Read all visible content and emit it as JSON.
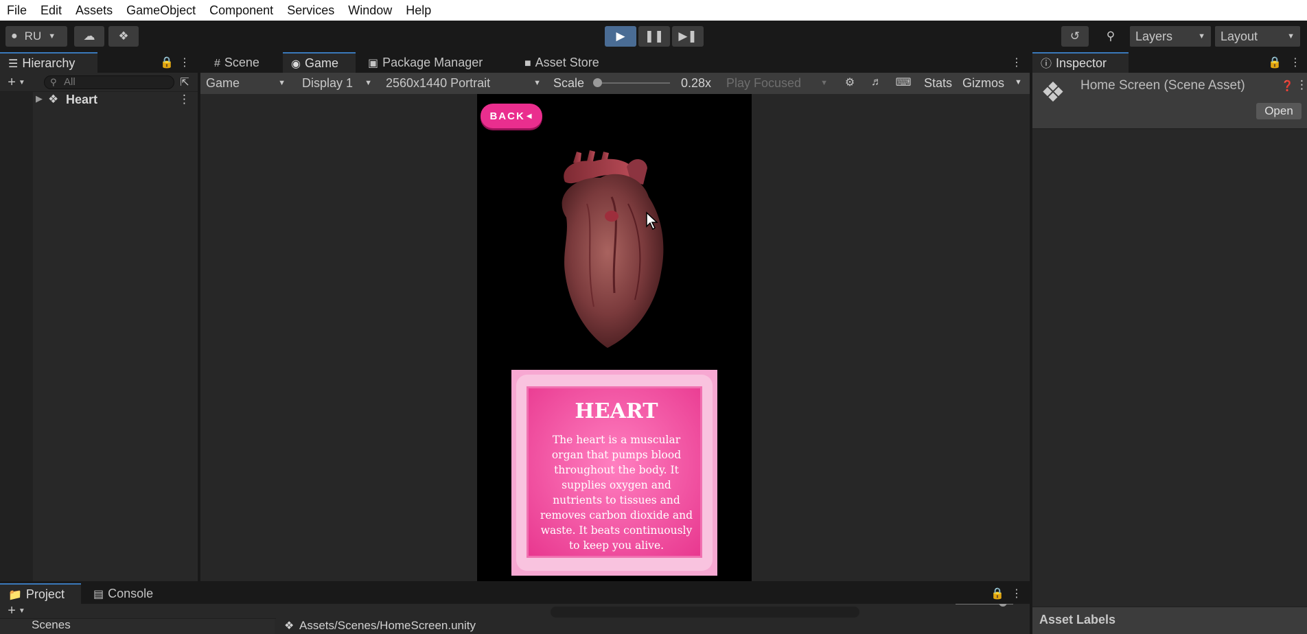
{
  "menu": [
    "File",
    "Edit",
    "Assets",
    "GameObject",
    "Component",
    "Services",
    "Window",
    "Help"
  ],
  "toolbar": {
    "account_label": "RU",
    "layers_label": "Layers",
    "layout_label": "Layout"
  },
  "hierarchy": {
    "tab_label": "Hierarchy",
    "search_placeholder": "All",
    "root_item": "Heart"
  },
  "center_tabs": {
    "scene": "Scene",
    "game": "Game",
    "package_manager": "Package Manager",
    "asset_store": "Asset Store"
  },
  "game_toolbar": {
    "mode": "Game",
    "display": "Display 1",
    "resolution": "2560x1440 Portrait",
    "scale_label": "Scale",
    "scale_value": "0.28x",
    "play_focused": "Play Focused",
    "stats": "Stats",
    "gizmos": "Gizmos"
  },
  "game": {
    "back_label": "BACK",
    "card_title": "HEART",
    "card_text": "The heart is a muscular organ that pumps blood throughout the body. It supplies oxygen and nutrients to tissues and removes carbon dioxide and waste. It beats continuously to keep you alive."
  },
  "inspector": {
    "tab_label": "Inspector",
    "asset_title": "Home Screen (Scene Asset)",
    "open_label": "Open",
    "asset_labels": "Asset Labels"
  },
  "bottom": {
    "project_tab": "Project",
    "console_tab": "Console",
    "folder_item": "Scenes",
    "path": "Assets/Scenes/HomeScreen.unity"
  },
  "colors": {
    "accent_blue": "#3a79bb",
    "pink": "#ea2e8e"
  }
}
